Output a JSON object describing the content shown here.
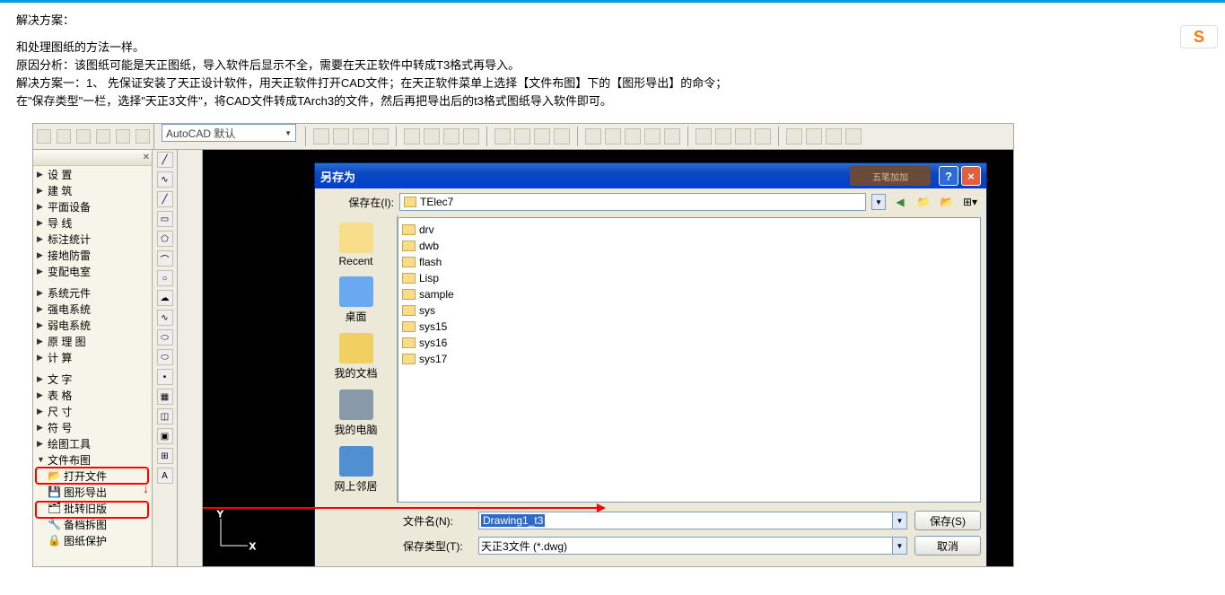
{
  "doc": {
    "title": "解决方案：",
    "line1": "和处理图纸的方法一样。",
    "line2": "原因分析：该图纸可能是天正图纸，导入软件后显示不全，需要在天正软件中转成T3格式再导入。",
    "line3": "解决方案一：1、 先保证安装了天正设计软件，用天正软件打开CAD文件；在天正软件菜单上选择【文件布图】下的【图形导出】的命令；",
    "line4": "在\"保存类型\"一栏，选择\"天正3文件\"，将CAD文件转成TArch3的文件，然后再把导出后的t3格式图纸导入软件即可。"
  },
  "toolbar": {
    "style_dd": "AutoCAD 默认"
  },
  "menu": {
    "items": [
      {
        "label": "设 置",
        "arw": "▶"
      },
      {
        "label": "建 筑",
        "arw": "▶"
      },
      {
        "label": "平面设备",
        "arw": "▶"
      },
      {
        "label": "导 线",
        "arw": "▶"
      },
      {
        "label": "标注统计",
        "arw": "▶"
      },
      {
        "label": "接地防雷",
        "arw": "▶"
      },
      {
        "label": "变配电室",
        "arw": "▶"
      },
      {
        "label": "系统元件",
        "arw": "▶"
      },
      {
        "label": "强电系统",
        "arw": "▶"
      },
      {
        "label": "弱电系统",
        "arw": "▶"
      },
      {
        "label": "原 理 图",
        "arw": "▶"
      },
      {
        "label": "计 算",
        "arw": "▶"
      },
      {
        "label": "文 字",
        "arw": "▶"
      },
      {
        "label": "表 格",
        "arw": "▶"
      },
      {
        "label": "尺 寸",
        "arw": "▶"
      },
      {
        "label": "符 号",
        "arw": "▶"
      },
      {
        "label": "绘图工具",
        "arw": "▶"
      },
      {
        "label": "文件布图",
        "arw": "▼"
      },
      {
        "label": "打开文件",
        "arw": "",
        "glyph": "📂"
      },
      {
        "label": "图形导出",
        "arw": "",
        "glyph": "💾"
      },
      {
        "label": "批转旧版",
        "arw": "",
        "glyph": "🗂"
      },
      {
        "label": "备档拆图",
        "arw": "",
        "glyph": "🔧"
      },
      {
        "label": "图纸保护",
        "arw": "",
        "glyph": "🔒"
      }
    ]
  },
  "saveas": {
    "title": "另存为",
    "deco_text": "五笔加加",
    "help": "?",
    "close": "×",
    "location_label": "保存在(I):",
    "location_value": "TElec7",
    "places": [
      {
        "label": "Recent",
        "color": "#f7dd8a"
      },
      {
        "label": "桌面",
        "color": "#6aa8f0"
      },
      {
        "label": "我的文档",
        "color": "#f0d060"
      },
      {
        "label": "我的电脑",
        "color": "#8899aa"
      },
      {
        "label": "网上邻居",
        "color": "#5090d0"
      }
    ],
    "files": [
      "drv",
      "dwb",
      "flash",
      "Lisp",
      "sample",
      "sys",
      "sys15",
      "sys16",
      "sys17"
    ],
    "filename_label": "文件名(N):",
    "filename_value": "Drawing1_t3",
    "filetype_label": "保存类型(T):",
    "filetype_value": "天正3文件 (*.dwg)",
    "save_btn": "保存(S)",
    "cancel_btn": "取消"
  },
  "badge": "S"
}
